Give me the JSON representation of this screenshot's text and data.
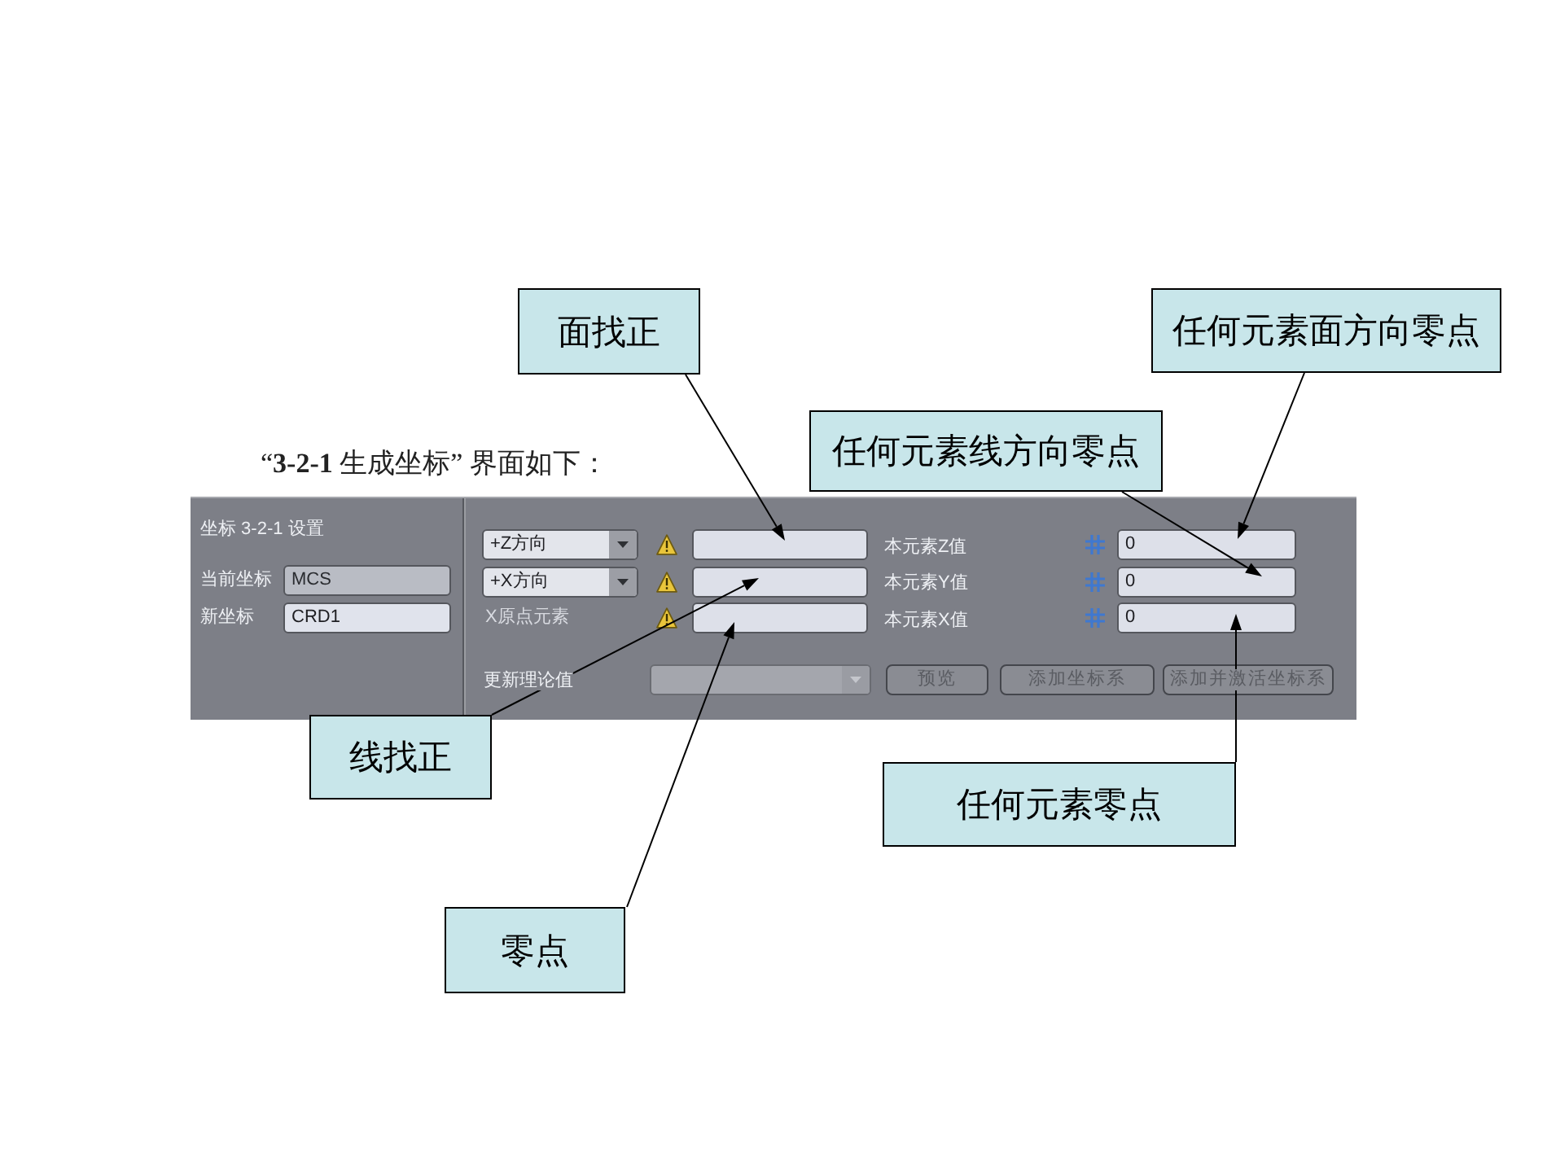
{
  "callouts": [
    "面找正",
    "任何元素面方向零点",
    "任何元素线方向零点",
    "线找正",
    "任何元素零点",
    "零点"
  ],
  "caption": "“**3-2-1** 生成坐标” 界面如下：",
  "panel": {
    "title": "坐标 3-2-1 设置",
    "coordinates": [
      {
        "label": "当前坐标",
        "value": "MCS",
        "disabled": true
      },
      {
        "label": "新坐标",
        "value": "CRD1",
        "disabled": false
      }
    ],
    "element_rows": [
      {
        "kind": "dropdown",
        "selector": "+Z方向",
        "value_label": "本元素Z值",
        "value": "0"
      },
      {
        "kind": "dropdown",
        "selector": "+X方向",
        "value_label": "本元素Y值",
        "value": "0"
      },
      {
        "kind": "label",
        "selector": "X原点元素",
        "value_label": "本元素X值",
        "value": "0"
      }
    ],
    "update": {
      "label": "更新理论值",
      "disabled": true
    },
    "buttons": [
      {
        "label": "预览",
        "disabled": true
      },
      {
        "label": "添加坐标系",
        "disabled": true
      },
      {
        "label": "添加并激活坐标系",
        "disabled": true
      }
    ]
  }
}
